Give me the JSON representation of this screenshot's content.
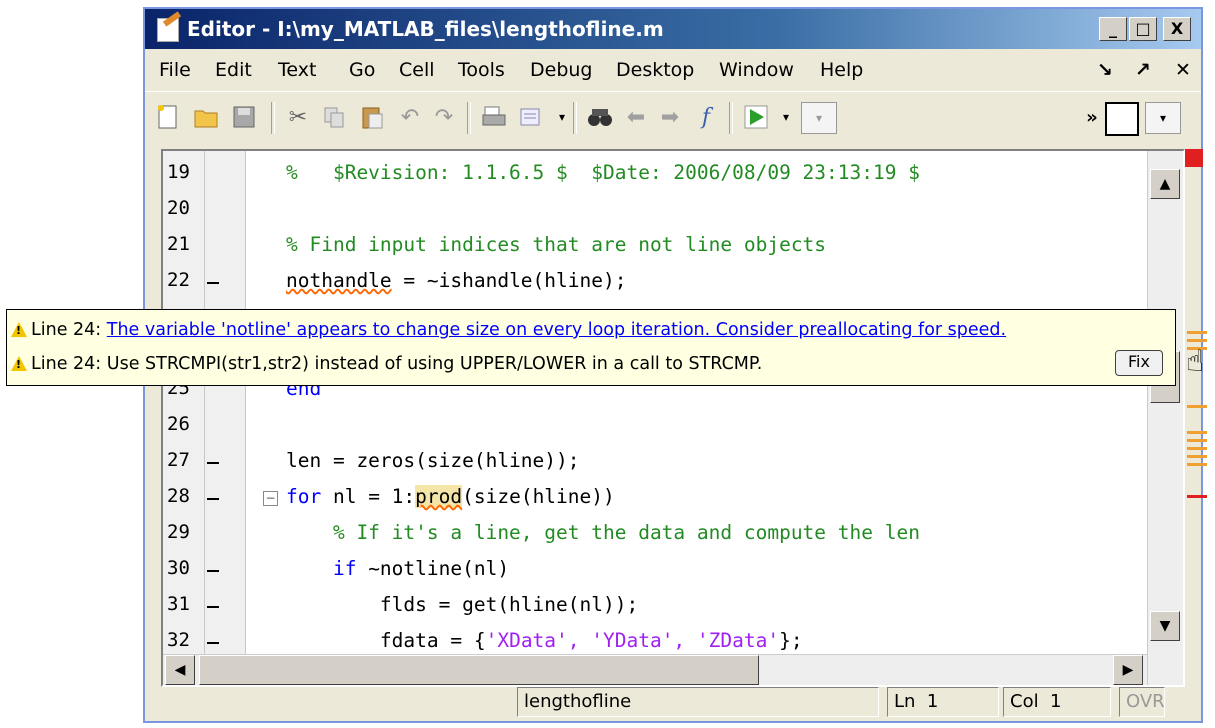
{
  "window": {
    "title": "Editor - I:\\my_MATLAB_files\\lengthofline.m",
    "min": "_",
    "max": "□",
    "close": "X"
  },
  "menu": [
    "File",
    "Edit",
    "Text",
    "Go",
    "Cell",
    "Tools",
    "Debug",
    "Desktop",
    "Window",
    "Help"
  ],
  "menu_right": [
    "↘",
    "↗",
    "✕"
  ],
  "toolbar": {
    "icons": [
      "new-file-icon",
      "open-folder-icon",
      "save-icon",
      "cut-icon",
      "copy-icon",
      "paste-icon",
      "undo-icon",
      "redo-icon",
      "print-icon",
      "cell-icon",
      "dropdown-icon",
      "find-icon",
      "back-icon",
      "forward-icon",
      "function-icon",
      "run-icon",
      "run-dropdown-icon",
      "stack-dropdown-icon",
      "more-icon",
      "layout-icon",
      "layout-dropdown-icon"
    ],
    "fx": "f",
    "more": "»"
  },
  "lines": [
    {
      "num": "19",
      "text": "%   $Revision: 1.1.6.5 $  $Date: 2006/08/09 23:13:19 $"
    },
    {
      "num": "20",
      "text": ""
    },
    {
      "num": "21",
      "text": "% Find input indices that are not line objects"
    },
    {
      "num": "22",
      "text": "nothandle = ~ishandle(hline);"
    },
    {
      "num": "25",
      "text": "end"
    },
    {
      "num": "26",
      "text": ""
    },
    {
      "num": "27",
      "text": "len = zeros(size(hline));"
    },
    {
      "num": "28",
      "kw": "for",
      "rest": " nl = 1:",
      "fn": "prod",
      "rest2": "(size(hline))"
    },
    {
      "num": "29",
      "text": "    % If it's a line, get the data and compute the len"
    },
    {
      "num": "30",
      "kw": "if",
      "rest": " ~notline(nl)"
    },
    {
      "num": "31",
      "text": "        flds = get(hline(nl));"
    },
    {
      "num": "32",
      "pre": "        fdata = {",
      "strs": "'XData', 'YData', 'ZData'",
      "post": "};"
    }
  ],
  "tooltip": {
    "line1_prefix": "Line 24:",
    "line1_link": "The variable 'notline' appears to change size on every loop iteration. Consider preallocating for speed.",
    "line2_prefix": "Line 24:",
    "line2_text": "Use STRCMPI(str1,str2) instead of using UPPER/LOWER in a call to STRCMP.",
    "fix_button": "Fix"
  },
  "status": {
    "function": "lengthofline",
    "ln_label": "Ln",
    "ln": "1",
    "col_label": "Col",
    "col": "1",
    "ovr": "OVR"
  },
  "colors": {
    "comment": "#228b22",
    "keyword": "#0000ff",
    "string": "#a020f0",
    "warning_marker": "#f0a030",
    "error_marker": "#e02020"
  }
}
